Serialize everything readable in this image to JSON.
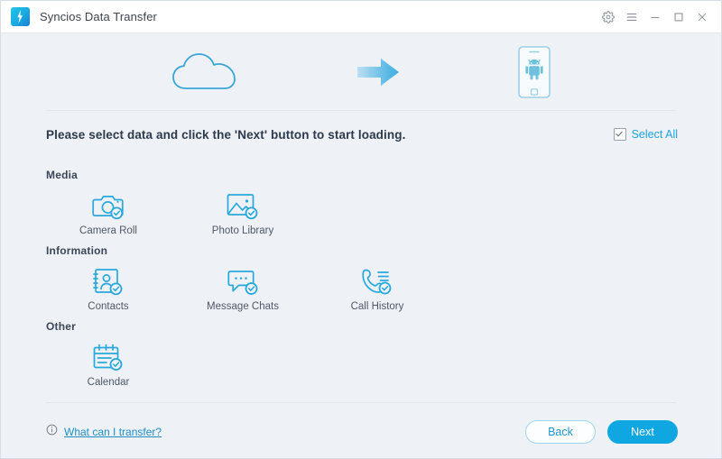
{
  "window": {
    "title": "Syncios Data Transfer",
    "logo_icon": "syncios-logo-icon",
    "controls": [
      {
        "name": "settings-button",
        "icon": "gear-icon"
      },
      {
        "name": "menu-button",
        "icon": "hamburger-menu-icon"
      },
      {
        "name": "minimize-button",
        "icon": "minimize-icon"
      },
      {
        "name": "maximize-button",
        "icon": "maximize-icon"
      },
      {
        "name": "close-button",
        "icon": "close-icon"
      }
    ]
  },
  "banner": {
    "source_icon": "cloud-icon",
    "arrow_icon": "arrow-right-icon",
    "target_icon": "android-phone-icon"
  },
  "instruction": "Please select data and click the 'Next' button to start loading.",
  "select_all": {
    "label": "Select All",
    "checked": true,
    "icon": "checkbox-checked-icon"
  },
  "sections": [
    {
      "title": "Media",
      "items": [
        {
          "label": "Camera Roll",
          "icon": "camera-icon",
          "selected": true
        },
        {
          "label": "Photo Library",
          "icon": "photo-library-icon",
          "selected": true
        }
      ]
    },
    {
      "title": "Information",
      "items": [
        {
          "label": "Contacts",
          "icon": "contact-card-icon",
          "selected": true
        },
        {
          "label": "Message Chats",
          "icon": "chat-bubble-icon",
          "selected": true
        },
        {
          "label": "Call History",
          "icon": "phone-call-icon",
          "selected": true
        }
      ]
    },
    {
      "title": "Other",
      "items": [
        {
          "label": "Calendar",
          "icon": "calendar-icon",
          "selected": true
        }
      ]
    }
  ],
  "footer": {
    "help_label": "What can I transfer?",
    "help_icon": "info-circle-icon",
    "back_label": "Back",
    "next_label": "Next"
  },
  "colors": {
    "accent": "#10a6e2",
    "icon_blue": "#29a8dd",
    "background": "#eef1f6",
    "titlebar": "#ffffff",
    "link": "#1f8ec4",
    "text": "#3c4450"
  }
}
